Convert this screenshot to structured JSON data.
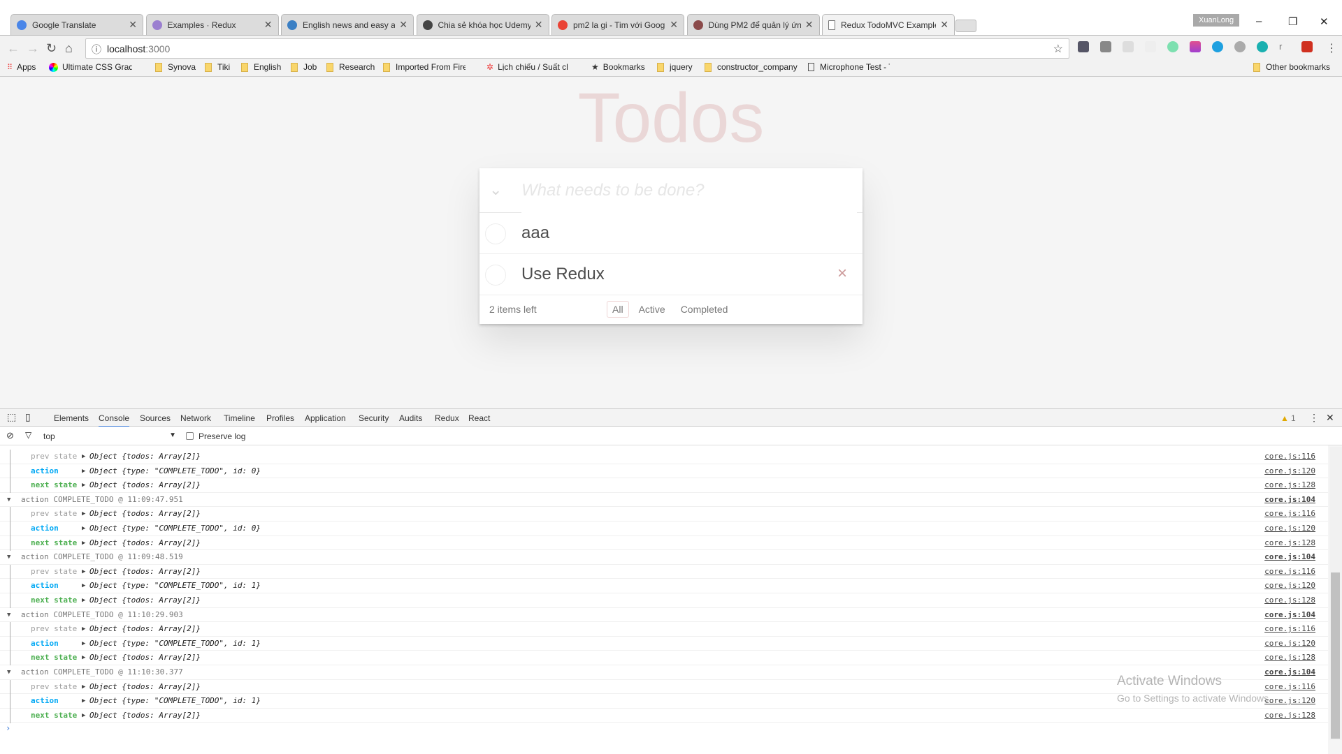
{
  "browser": {
    "tabs": [
      {
        "title": "Google Translate",
        "color": "#4a86e8"
      },
      {
        "title": "Examples · Redux",
        "color": "#9b7fd0"
      },
      {
        "title": "English news and easy ar",
        "color": "#3a7fc4"
      },
      {
        "title": "Chia sẻ khóa học Udemy",
        "color": "#444"
      },
      {
        "title": "pm2 la gi - Tim với Goog",
        "color": "#ea4335"
      },
      {
        "title": "Dùng PM2 để quản lý ứn",
        "color": "#8b4a4a"
      },
      {
        "title": "Redux TodoMVC Example",
        "color": "#fff"
      }
    ],
    "active_tab": 6,
    "user": "XuanLong",
    "url_host": "localhost",
    "url_port": ":3000",
    "bookmarks": [
      "Apps",
      "Ultimate CSS Gradient",
      "Synova",
      "Tiki",
      "English",
      "Job",
      "Research",
      "Imported From Firefox",
      "Lịch chiếu / Suất chiếu",
      "Bookmarks",
      "jquery",
      "constructor_company",
      "Microphone Test - Tes"
    ],
    "other_bookmarks": "Other bookmarks"
  },
  "todo": {
    "title": "Todos",
    "placeholder": "What needs to be done?",
    "items": [
      {
        "label": "aaa",
        "completed": false
      },
      {
        "label": "Use Redux",
        "completed": false
      }
    ],
    "count": "2 items left",
    "filters": [
      "All",
      "Active",
      "Completed"
    ],
    "selected_filter": "All"
  },
  "devtools": {
    "tabs": [
      "Elements",
      "Console",
      "Sources",
      "Network",
      "Timeline",
      "Profiles",
      "Application",
      "Security",
      "Audits",
      "Redux",
      "React"
    ],
    "selected_tab": "Console",
    "warnings": "1",
    "context": "top",
    "preserve_log": "Preserve log",
    "rows": [
      {
        "kind": "prev",
        "key": "prev state",
        "obj": "Object {todos: Array[2]}",
        "src": "core.js:116"
      },
      {
        "kind": "action",
        "key": "action",
        "obj": "Object {type: \"COMPLETE_TODO\", id: 0}",
        "src": "core.js:120"
      },
      {
        "kind": "next",
        "key": "next state",
        "obj": "Object {todos: Array[2]}",
        "src": "core.js:128"
      },
      {
        "kind": "head",
        "key": "action COMPLETE_TODO @ 11:09:47.951",
        "src": "core.js:104"
      },
      {
        "kind": "prev",
        "key": "prev state",
        "obj": "Object {todos: Array[2]}",
        "src": "core.js:116"
      },
      {
        "kind": "action",
        "key": "action",
        "obj": "Object {type: \"COMPLETE_TODO\", id: 0}",
        "src": "core.js:120"
      },
      {
        "kind": "next",
        "key": "next state",
        "obj": "Object {todos: Array[2]}",
        "src": "core.js:128"
      },
      {
        "kind": "head",
        "key": "action COMPLETE_TODO @ 11:09:48.519",
        "src": "core.js:104"
      },
      {
        "kind": "prev",
        "key": "prev state",
        "obj": "Object {todos: Array[2]}",
        "src": "core.js:116"
      },
      {
        "kind": "action",
        "key": "action",
        "obj": "Object {type: \"COMPLETE_TODO\", id: 1}",
        "src": "core.js:120"
      },
      {
        "kind": "next",
        "key": "next state",
        "obj": "Object {todos: Array[2]}",
        "src": "core.js:128"
      },
      {
        "kind": "head",
        "key": "action COMPLETE_TODO @ 11:10:29.903",
        "src": "core.js:104"
      },
      {
        "kind": "prev",
        "key": "prev state",
        "obj": "Object {todos: Array[2]}",
        "src": "core.js:116"
      },
      {
        "kind": "action",
        "key": "action",
        "obj": "Object {type: \"COMPLETE_TODO\", id: 1}",
        "src": "core.js:120"
      },
      {
        "kind": "next",
        "key": "next state",
        "obj": "Object {todos: Array[2]}",
        "src": "core.js:128"
      },
      {
        "kind": "head",
        "key": "action COMPLETE_TODO @ 11:10:30.377",
        "src": "core.js:104"
      },
      {
        "kind": "prev",
        "key": "prev state",
        "obj": "Object {todos: Array[2]}",
        "src": "core.js:116"
      },
      {
        "kind": "action",
        "key": "action",
        "obj": "Object {type: \"COMPLETE_TODO\", id: 1}",
        "src": "core.js:120"
      },
      {
        "kind": "next",
        "key": "next state",
        "obj": "Object {todos: Array[2]}",
        "src": "core.js:128"
      }
    ],
    "colors": {
      "prev": "#9e9e9e",
      "action": "#03a9f4",
      "next": "#4caf50",
      "head": "#777"
    }
  },
  "watermark": {
    "line1": "Activate Windows",
    "line2": "Go to Settings to activate Windows."
  }
}
